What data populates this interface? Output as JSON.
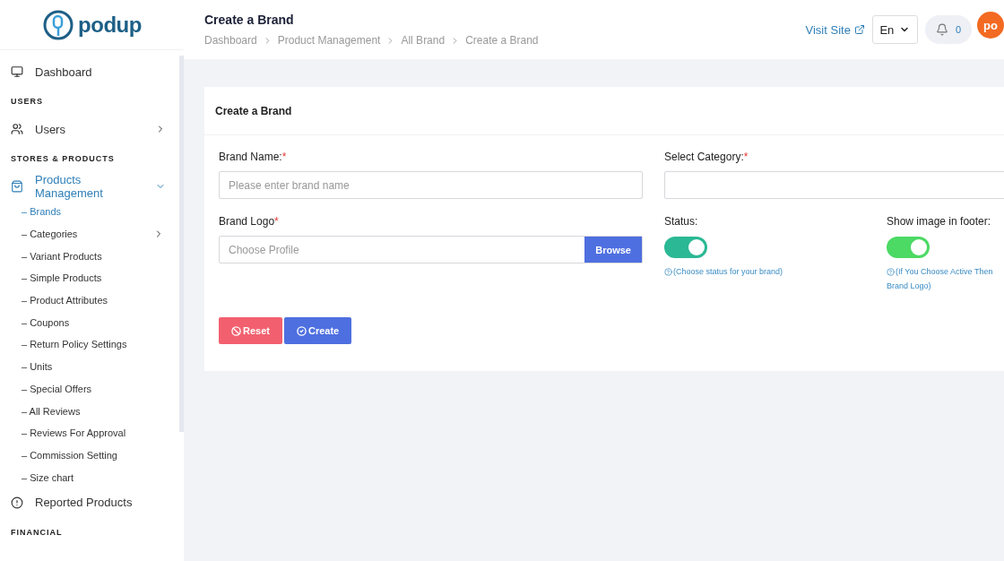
{
  "brand": {
    "logo_text": "podup"
  },
  "sidebar": {
    "items": [
      {
        "kind": "link",
        "label": "Dashboard",
        "selected": false
      },
      {
        "kind": "section",
        "label": "USERS"
      },
      {
        "kind": "link",
        "label": "Users",
        "selected": false,
        "expanded": false
      },
      {
        "kind": "section",
        "label": "STORES & PRODUCTS"
      },
      {
        "kind": "link",
        "label": "Products Management",
        "selected": true,
        "expanded": true,
        "children": [
          {
            "label": "– Brands",
            "selected": true
          },
          {
            "label": "– Categories",
            "selected": false,
            "expanded": false
          },
          {
            "label": "– Variant Products",
            "selected": false
          },
          {
            "label": "– Simple Products",
            "selected": false
          },
          {
            "label": "– Product Attributes",
            "selected": false
          },
          {
            "label": "– Coupons",
            "selected": false
          },
          {
            "label": "– Return Policy Settings",
            "selected": false
          },
          {
            "label": "– Units",
            "selected": false
          },
          {
            "label": "– Special Offers",
            "selected": false
          },
          {
            "label": "– All Reviews",
            "selected": false
          },
          {
            "label": "– Reviews For Approval",
            "selected": false
          },
          {
            "label": "– Commission Setting",
            "selected": false
          },
          {
            "label": "– Size chart",
            "selected": false
          }
        ]
      },
      {
        "kind": "link",
        "label": "Reported Products",
        "selected": false
      },
      {
        "kind": "section",
        "label": "FINANCIAL"
      }
    ]
  },
  "header": {
    "title": "Create a Brand",
    "breadcrumb": [
      "Dashboard",
      "Product Management",
      "All Brand",
      "Create a Brand"
    ],
    "visit_site": "Visit Site",
    "language": "En",
    "notifications": "0",
    "avatar": "po"
  },
  "card": {
    "title": "Create a Brand",
    "brand_name": {
      "label": "Brand Name:",
      "required_mark": "*",
      "placeholder": "Please enter brand name"
    },
    "category": {
      "label": "Select Category:",
      "required_mark": "*"
    },
    "brand_logo": {
      "label": "Brand Logo",
      "required_mark": "*",
      "placeholder": "Choose Profile",
      "button": "Browse"
    },
    "status": {
      "label": "Status:",
      "on": true,
      "hint_lines": [
        "(Choose status for your brand)"
      ]
    },
    "footer_image": {
      "label": "Show image in footer:",
      "on": true,
      "hint_lines": [
        "(If You Choose Active Then",
        "Brand Logo)"
      ]
    },
    "buttons": [
      {
        "kind": "reset",
        "label": "Reset"
      },
      {
        "kind": "create",
        "label": "Create"
      }
    ]
  }
}
